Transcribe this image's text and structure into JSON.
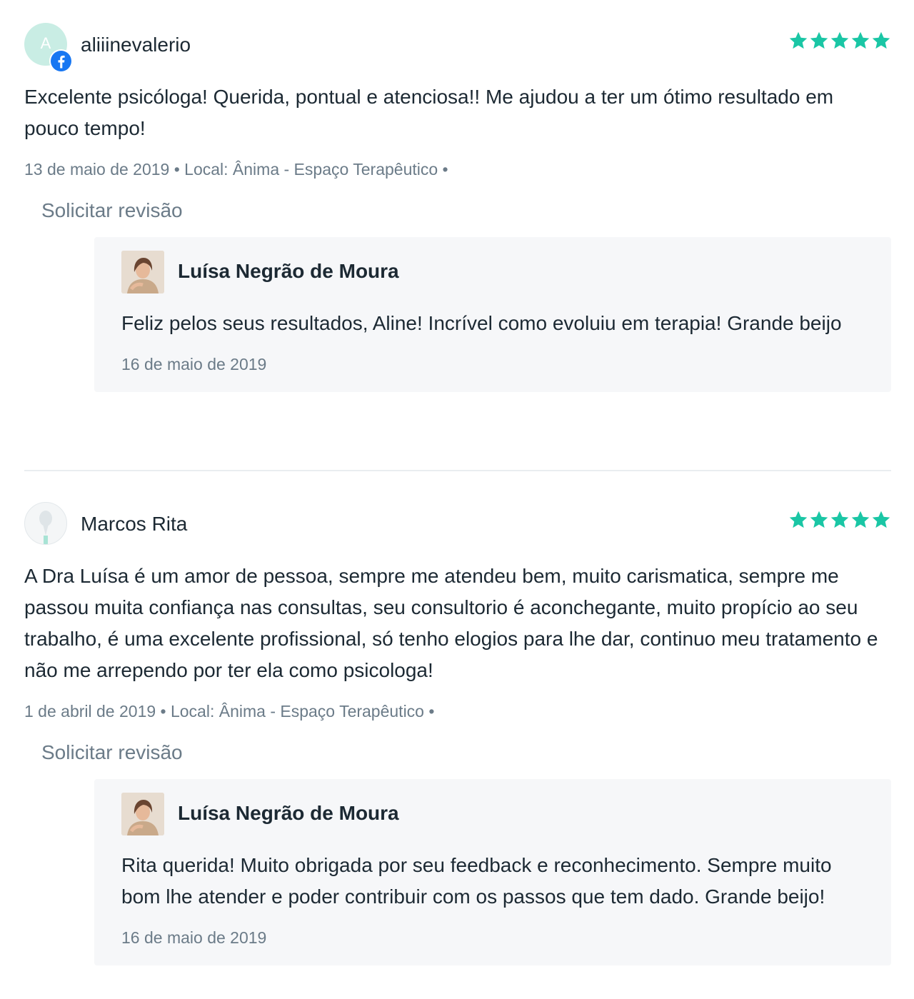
{
  "colors": {
    "star": "#1ac6a5",
    "text": "#1c2933",
    "muted": "#6b7b88",
    "reply_bg": "#f6f7f9",
    "facebook": "#1877f2"
  },
  "reviews": [
    {
      "avatar_letter": "A",
      "avatar_badge_icon": "facebook-icon",
      "author": "aliiinevalerio",
      "rating": 5,
      "text": "Excelente psicóloga! Querida, pontual e atenciosa!! Me ajudou a ter um ótimo resultado em pouco tempo!",
      "meta": "13 de maio de 2019 • Local: Ânima - Espaço Terapêutico •",
      "request_review_label": "Solicitar revisão",
      "reply": {
        "author": "Luísa Negrão de Moura",
        "text": "Feliz pelos seus resultados, Aline! Incrível como evoluiu em terapia! Grande beijo",
        "date": "16 de maio de 2019"
      }
    },
    {
      "avatar_icon": "anonymous-user-icon",
      "author": "Marcos Rita",
      "rating": 5,
      "text": "A Dra Luísa é um amor de pessoa, sempre me atendeu bem, muito carismatica, sempre me passou muita confiança nas consultas, seu consultorio é aconchegante, muito propício ao seu trabalho, é uma excelente profissional, só tenho elogios para lhe dar, continuo meu tratamento e não me arrependo por ter ela como psicologa!",
      "meta": "1 de abril de 2019 • Local: Ânima - Espaço Terapêutico •",
      "request_review_label": "Solicitar revisão",
      "reply": {
        "author": "Luísa Negrão de Moura",
        "text": "Rita querida! Muito obrigada por seu feedback e reconhecimento. Sempre muito bom lhe atender e poder contribuir com os passos que tem dado. Grande beijo!",
        "date": "16 de maio de 2019"
      }
    }
  ]
}
